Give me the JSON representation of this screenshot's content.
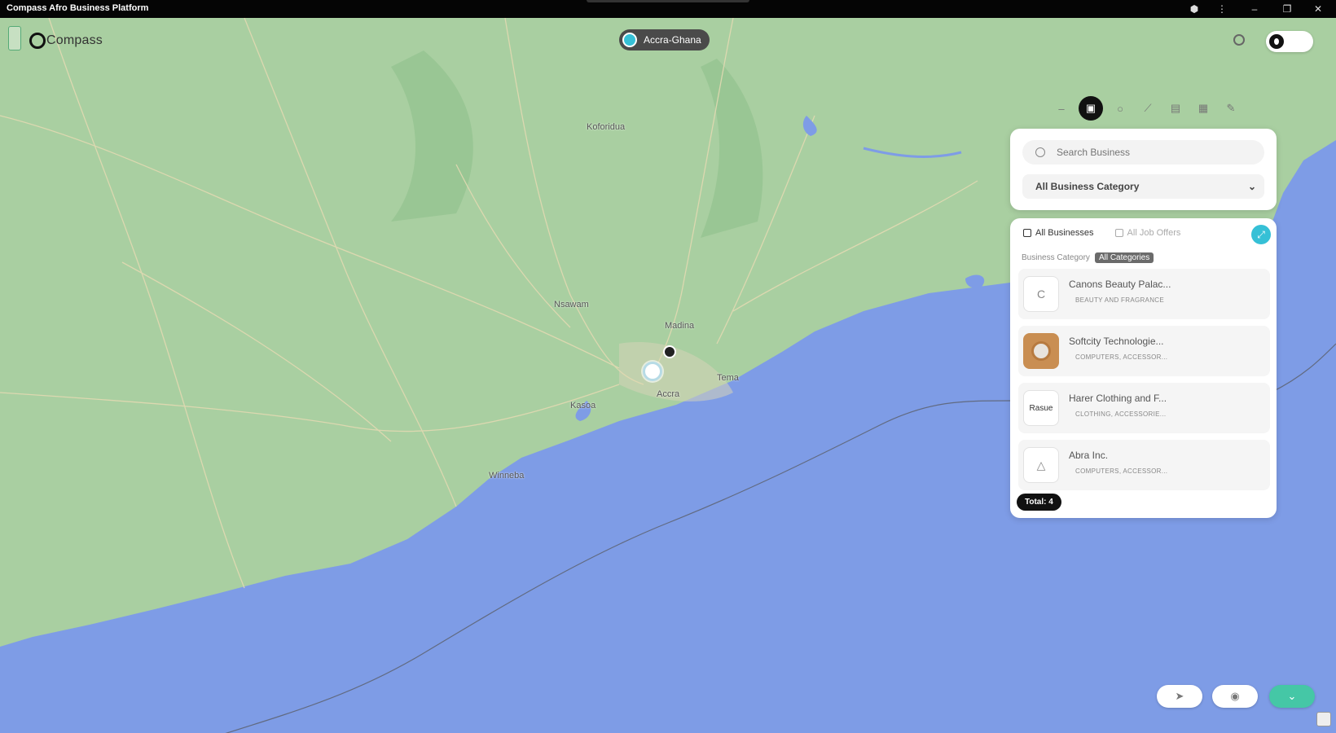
{
  "window": {
    "title": "Compass Afro Business Platform"
  },
  "brand": {
    "name": "Compass"
  },
  "location": {
    "label": "Accra-Ghana"
  },
  "search": {
    "placeholder": "Search Business"
  },
  "category_select": {
    "value": "All Business Category"
  },
  "tabs": [
    {
      "label": "All Businesses",
      "active": true
    },
    {
      "label": "All Job Offers",
      "active": false
    }
  ],
  "breadcrumb": {
    "label": "Business Category",
    "badge": "All Categories"
  },
  "businesses": [
    {
      "name": "Canons Beauty Palac...",
      "category": "BEAUTY AND FRAGRANCE",
      "thumb": "C"
    },
    {
      "name": "Softcity Technologie...",
      "category": "COMPUTERS, ACCESSOR...",
      "thumb": ""
    },
    {
      "name": "Harer Clothing and F...",
      "category": "CLOTHING, ACCESSORIE...",
      "thumb": "Rasue"
    },
    {
      "name": "Abra Inc.",
      "category": "COMPUTERS, ACCESSOR...",
      "thumb": "△"
    }
  ],
  "total": {
    "label": "Total: 4"
  },
  "map_labels": [
    {
      "text": "Madina"
    },
    {
      "text": "Accra"
    },
    {
      "text": "Kasoa"
    },
    {
      "text": "Koforidua"
    },
    {
      "text": "Nsawam"
    },
    {
      "text": "Winneba"
    },
    {
      "text": "Tema"
    }
  ],
  "colors": {
    "water": "#7e9ce6",
    "land": "#a9cfa1",
    "accent": "#36c0d6",
    "teal": "#45c7a6"
  },
  "icons": {
    "globe": "globe-icon",
    "share": "share-icon",
    "locate": "navigate-icon",
    "eye": "eye-icon",
    "expand": "chevron-down-icon"
  }
}
